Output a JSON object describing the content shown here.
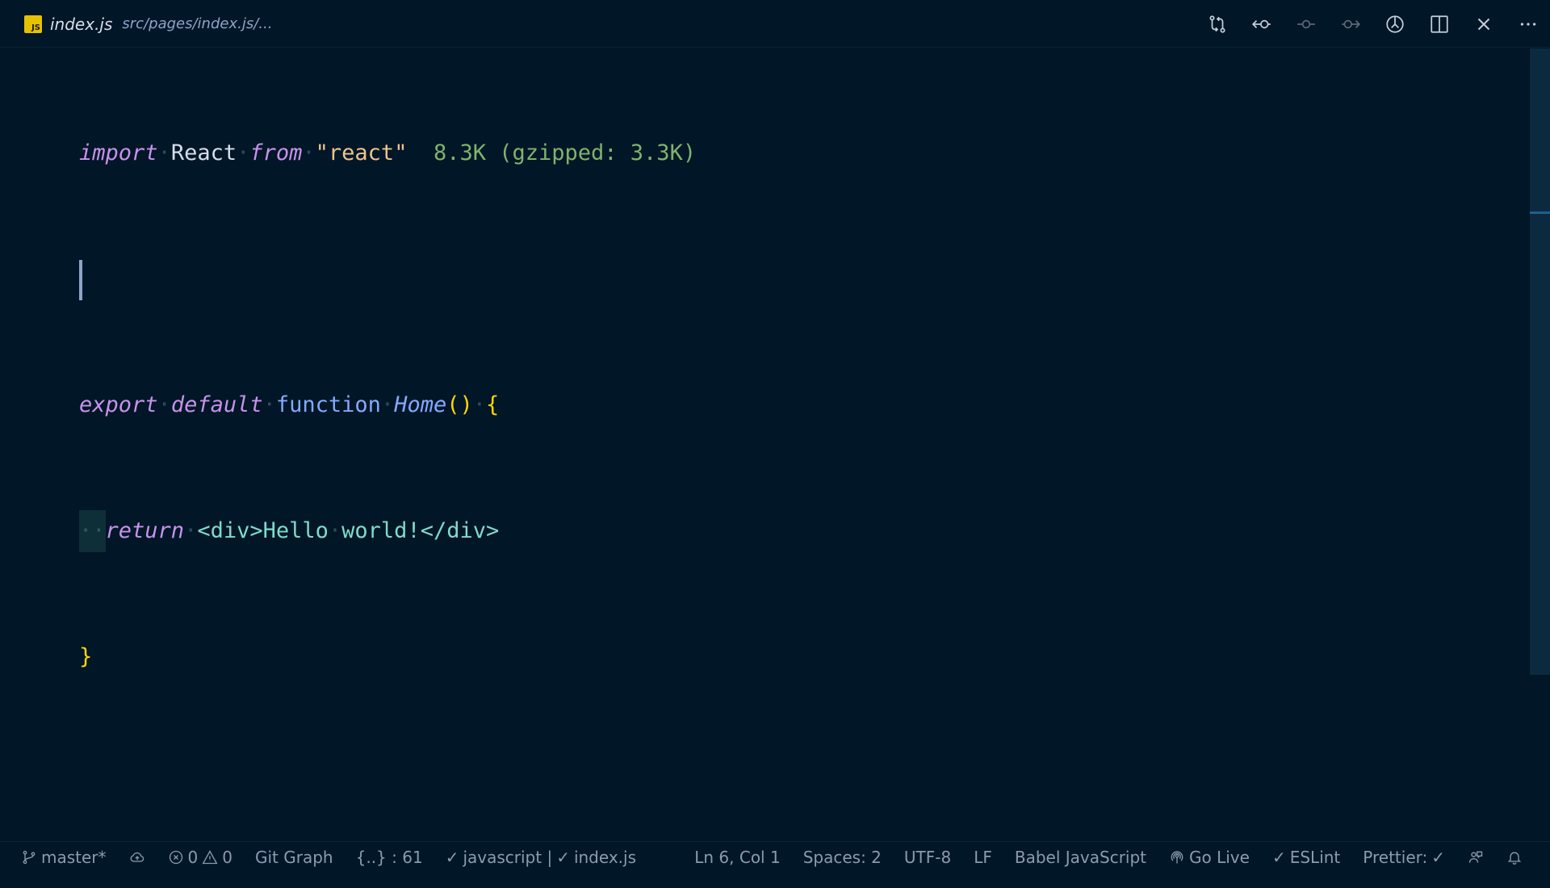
{
  "tab": {
    "file_name": "index.js",
    "file_path": "src/pages/index.js/...",
    "badge": "JS"
  },
  "actions": [
    {
      "name": "git-compare-icon",
      "dim": false
    },
    {
      "name": "go-back-icon",
      "dim": false
    },
    {
      "name": "git-commit-icon",
      "dim": true
    },
    {
      "name": "go-forward-icon",
      "dim": true
    },
    {
      "name": "timeline-icon",
      "dim": false
    },
    {
      "name": "split-editor-icon",
      "dim": false
    },
    {
      "name": "close-icon",
      "dim": false
    },
    {
      "name": "more-actions-icon",
      "dim": false
    }
  ],
  "code": {
    "line1": {
      "import": "import",
      "react": "React",
      "from": "from",
      "module": "\"react\"",
      "size_hint": "8.3K (gzipped: 3.3K)"
    },
    "line3": {
      "export": "export",
      "default": "default",
      "function": "function",
      "name": "Home",
      "parens": "()",
      "open_brace": "{"
    },
    "line4": {
      "return": "return",
      "open_tag": "<div>",
      "text1": "Hello",
      "text2": "world!",
      "close_tag": "</div>"
    },
    "line5": {
      "close_brace": "}"
    }
  },
  "status": {
    "branch": "master*",
    "errors": "0",
    "warnings": "0",
    "git_graph": "Git Graph",
    "symbols": "{..} : 61",
    "lang_check": "javascript | ",
    "file_check": "index.js",
    "position": "Ln 6, Col 1",
    "spaces": "Spaces: 2",
    "encoding": "UTF-8",
    "eol": "LF",
    "language": "Babel JavaScript",
    "go_live": "Go Live",
    "eslint": "ESLint",
    "prettier": "Prettier:"
  },
  "colors": {
    "background": "#011627",
    "keyword": "#c792ea",
    "function": "#82aaff",
    "string": "#ecc48d",
    "jsx": "#7fdbca",
    "brace": "#ffd700",
    "hint": "#7fb36b"
  }
}
